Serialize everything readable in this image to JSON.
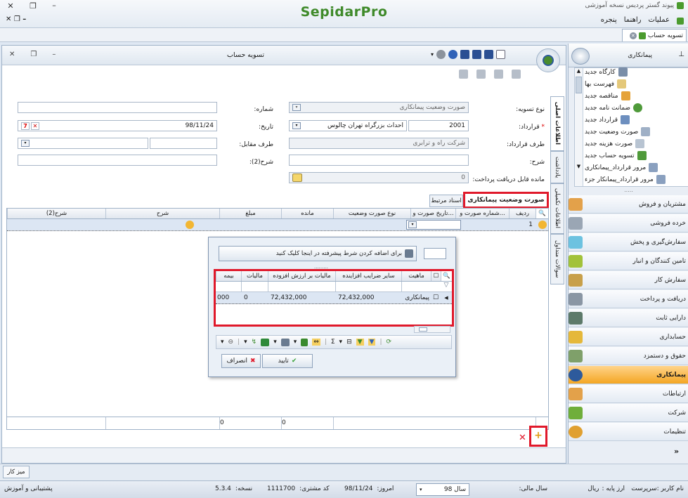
{
  "app": {
    "logo": "SepidarPro",
    "window_caption": "پیوند گستر پردیس نسخه آموزشی"
  },
  "menu": {
    "operations": "عملیات",
    "help": "راهنما",
    "window": "پنجره"
  },
  "doc_tab": {
    "label": "تسویه حساب"
  },
  "window": {
    "title": "تسویه حساب"
  },
  "form": {
    "settlement_type_label": "نوع تسویه:",
    "settlement_type_value": "صورت وضعیت پیمانکاری",
    "number_label": "شماره:",
    "number_value": "",
    "contract_label": "قرارداد:",
    "contract_code": "2001",
    "contract_name": "احداث بزرگراه تهران چالوس",
    "date_label": "تاریخ:",
    "date_value": "98/11/24",
    "party_label": "طرف قرارداد:",
    "party_value": "شرکت راه و ترابری",
    "counter_label": "طرف مقابل:",
    "desc_label": "شرح:",
    "desc2_label": "شرح(2):",
    "balance_label": "مانده قابل دریافت پرداخت:",
    "balance_value": "0"
  },
  "side_tabs": [
    "اطلاعات اصلی",
    "یادداشت",
    "اطلاعات تکمیلی",
    "سوالات متداول"
  ],
  "tabs": {
    "active": "صورت وضعیت پیمانکاری",
    "inactive": "اسناد مرتبط"
  },
  "grid": {
    "columns": [
      "ردیف",
      "شماره صورت و...",
      "تاریخ صورت و...",
      "نوع صورت وضعیت",
      "مانده",
      "مبلغ",
      "شرح",
      "شرح(2)"
    ],
    "row_number": "1",
    "footer_totals": [
      "0",
      "0"
    ]
  },
  "popup": {
    "advanced_filter": "برای اضافه کردن شرط پیشرفته در اینجا کلیک کنید",
    "columns": [
      "ماهیت",
      "سایر ضرایب افزاینده",
      "مالیات بر ارزش افزوده",
      "مالیات",
      "بیمه"
    ],
    "row": {
      "nature": "پیمانکاری",
      "other_coef": "72,432,000",
      "vat": "72,432,000",
      "tax": "0",
      "insurance": "000"
    },
    "confirm": "تایید",
    "cancel": "انصراف"
  },
  "right_panel": {
    "title": "پیمانکاری",
    "items": [
      "کارگاه جدید",
      "فهرست بها",
      "مناقصه جدید",
      "ضمانت نامه جدید",
      "قرارداد جدید",
      "صورت وضعیت جدید",
      "صورت هزینه جدید",
      "تسویه حساب جدید",
      "مرور قرارداد_پیمانکاری",
      "مرور قرارداد_پیمانکار جزء"
    ],
    "nav": [
      "مشتریان و فروش",
      "خرده فروشی",
      "سفارش‌گیری و پخش",
      "تامین کنندگان و انبار",
      "سفارش کار",
      "دریافت و پرداخت",
      "دارایی ثابت",
      "حسابداری",
      "حقوق و دستمزد",
      "پیمانکاری",
      "ارتباطات",
      "شرکت",
      "تنظیمات"
    ]
  },
  "taskbar": {
    "desk": "میز کار"
  },
  "status": {
    "user": "نام کاربر :سرپرست",
    "base_currency_label": "ارز پایه :",
    "base_currency": "ریال",
    "fiscal_year_label": "سال مالی:",
    "fiscal_year": "سال 98",
    "today_label": "امروز:",
    "today": "98/11/24",
    "customer_code_label": "کد مشتری:",
    "customer_code": "1111700",
    "version_label": "نسخه:",
    "version": "5.3.4",
    "support": "پشتیبانی و آموزش"
  }
}
